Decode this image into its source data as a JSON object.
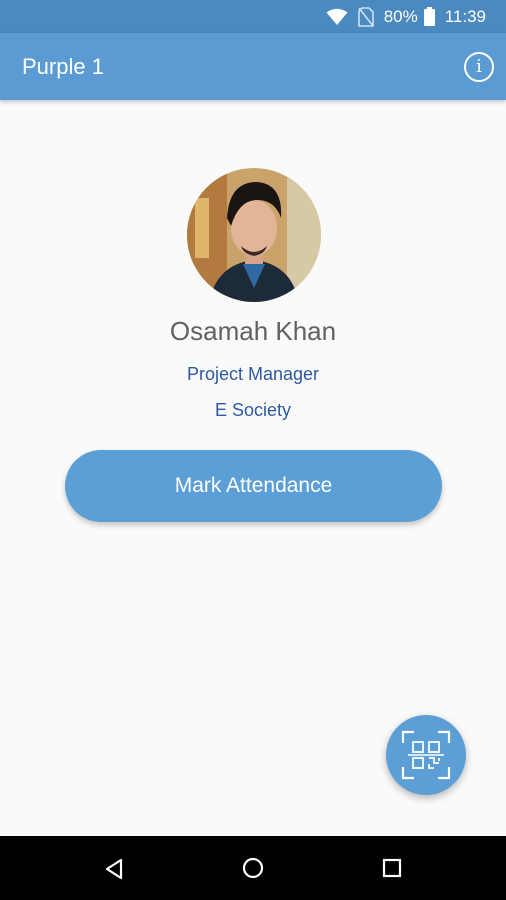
{
  "status_bar": {
    "battery_percent": "80%",
    "time": "11:39",
    "icons": [
      "wifi-icon",
      "no-sim-icon",
      "battery-icon"
    ]
  },
  "app_bar": {
    "title": "Purple 1",
    "info_icon": "info-icon"
  },
  "profile": {
    "name": "Osamah Khan",
    "role": "Project Manager",
    "organization": "E Society"
  },
  "actions": {
    "mark_attendance_label": "Mark Attendance",
    "scan_icon": "qr-scan-icon"
  },
  "nav_bar": {
    "icons": [
      "back-icon",
      "home-icon",
      "recents-icon"
    ]
  },
  "colors": {
    "status_bar": "#4a8ac0",
    "app_bar": "#5a9bd3",
    "accent": "#5b9fd6",
    "link_text": "#2d5aa0",
    "name_text": "#616161",
    "background": "#fafafa"
  }
}
